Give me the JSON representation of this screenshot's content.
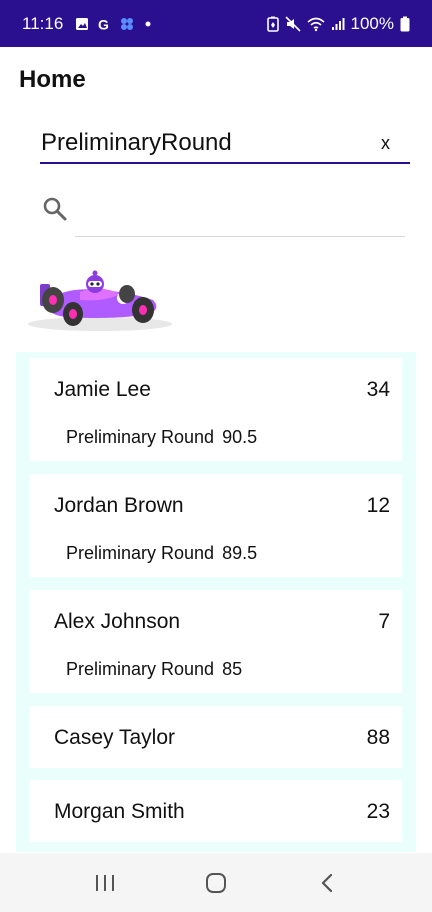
{
  "status": {
    "time": "11:16",
    "battery": "100%",
    "icons": [
      "gallery-icon",
      "google-icon",
      "app-icon",
      "dot-icon",
      "battery-saver-icon",
      "mute-icon",
      "wifi-icon",
      "signal-icon",
      "battery-icon"
    ]
  },
  "header": {
    "title": "Home"
  },
  "filter": {
    "value": "PreliminaryRound",
    "clear_label": "x"
  },
  "search": {
    "placeholder": "",
    "icon": "search-icon"
  },
  "colors": {
    "status_bar": "#2a0f8f",
    "list_bg": "#eafffc",
    "accent": "#2a0f8f"
  },
  "entries": [
    {
      "name": "Jamie Lee",
      "score": "34",
      "round": "Preliminary Round",
      "round_score": "90.5"
    },
    {
      "name": "Jordan Brown",
      "score": "12",
      "round": "Preliminary Round",
      "round_score": "89.5"
    },
    {
      "name": "Alex Johnson",
      "score": "7",
      "round": "Preliminary Round",
      "round_score": "85"
    },
    {
      "name": "Casey Taylor",
      "score": "88"
    },
    {
      "name": "Morgan Smith",
      "score": "23"
    }
  ],
  "nav": {
    "icons": [
      "recent-apps-icon",
      "home-icon",
      "back-icon"
    ]
  }
}
